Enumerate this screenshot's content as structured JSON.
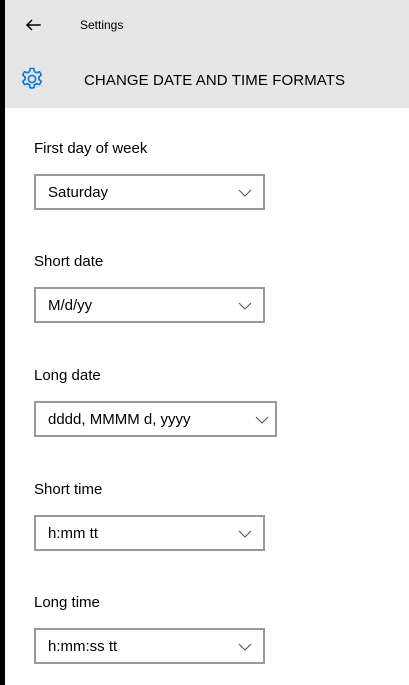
{
  "app": {
    "title": "Settings"
  },
  "header": {
    "title": "CHANGE DATE AND TIME FORMATS"
  },
  "icons": {
    "back": "back-arrow-icon",
    "header": "gear-icon",
    "dropdown": "chevron-down-icon"
  },
  "colors": {
    "header_bg": "#e6e6e6",
    "accent": "#0078d7",
    "select_border": "#999999"
  },
  "fields": [
    {
      "label": "First day of week",
      "value": "Saturday"
    },
    {
      "label": "Short date",
      "value": "M/d/yy"
    },
    {
      "label": "Long date",
      "value": "dddd, MMMM d, yyyy"
    },
    {
      "label": "Short time",
      "value": "h:mm tt"
    },
    {
      "label": "Long time",
      "value": "h:mm:ss tt"
    }
  ]
}
